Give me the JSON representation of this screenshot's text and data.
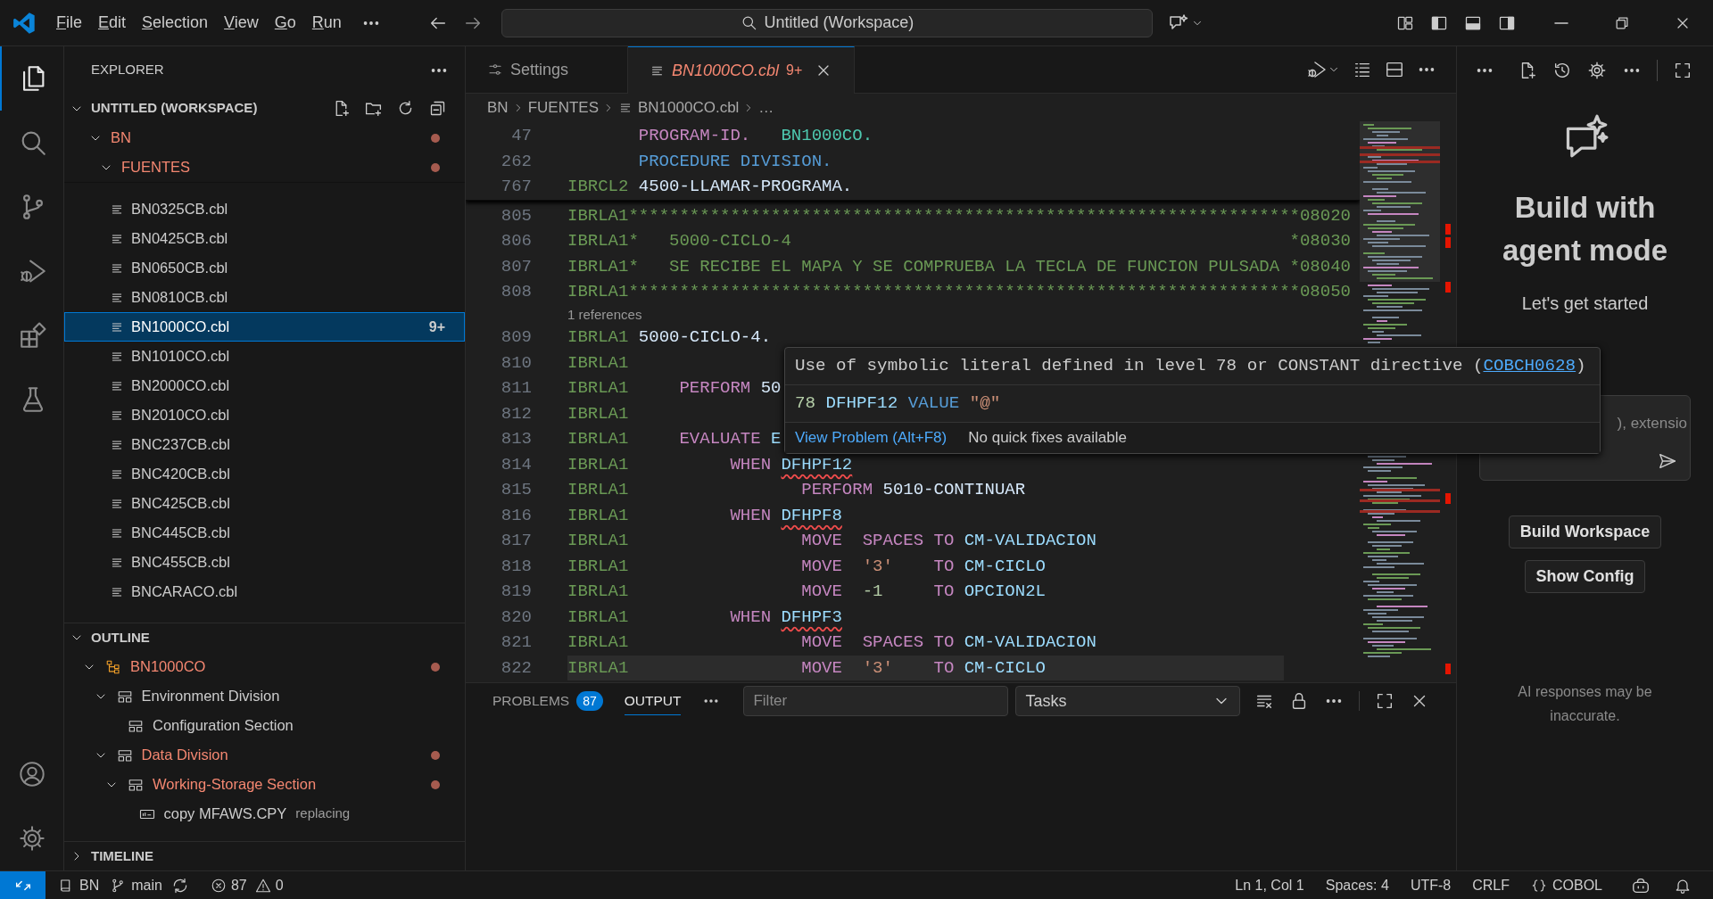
{
  "title_bar": {
    "menu": [
      "File",
      "Edit",
      "Selection",
      "View",
      "Go",
      "Run"
    ],
    "search": "Untitled (Workspace)"
  },
  "activity_bar": {
    "top": [
      {
        "kind": "explorer",
        "selected": true
      },
      {
        "kind": "search",
        "selected": false
      },
      {
        "kind": "source_control",
        "selected": false
      },
      {
        "kind": "run_debug",
        "selected": false
      },
      {
        "kind": "extensions",
        "selected": false
      },
      {
        "kind": "testing",
        "selected": false
      }
    ],
    "bottom": [
      {
        "kind": "accounts"
      },
      {
        "kind": "manage"
      }
    ]
  },
  "sidebar": {
    "title": "EXPLORER",
    "explorer": {
      "label": "UNTITLED (WORKSPACE)",
      "expanded": true,
      "tree": [
        {
          "label": "BN",
          "errors": true,
          "expanded": true,
          "children": [
            {
              "label": "FUENTES",
              "errors": true,
              "expanded": true,
              "children": [
                {
                  "label": "BN0325CB.cbl",
                  "selected": false
                },
                {
                  "label": "BN0425CB.cbl",
                  "selected": false
                },
                {
                  "label": "BN0650CB.cbl",
                  "selected": false
                },
                {
                  "label": "BN0810CB.cbl",
                  "selected": false
                },
                {
                  "label": "BN1000CO.cbl",
                  "selected": true,
                  "badge": "9+"
                },
                {
                  "label": "BN1010CO.cbl",
                  "selected": false
                },
                {
                  "label": "BN2000CO.cbl",
                  "selected": false
                },
                {
                  "label": "BN2010CO.cbl",
                  "selected": false
                },
                {
                  "label": "BNC237CB.cbl",
                  "selected": false
                },
                {
                  "label": "BNC420CB.cbl",
                  "selected": false
                },
                {
                  "label": "BNC425CB.cbl",
                  "selected": false
                },
                {
                  "label": "BNC445CB.cbl",
                  "selected": false
                },
                {
                  "label": "BNC455CB.cbl",
                  "selected": false
                },
                {
                  "label": "BNCARACO.cbl",
                  "selected": false
                }
              ]
            }
          ]
        }
      ]
    },
    "outline": {
      "label": "OUTLINE",
      "expanded": true,
      "tree": [
        {
          "label": "BN1000CO",
          "kind": "program",
          "errors": true,
          "expanded": true,
          "children": [
            {
              "label": "Environment Division",
              "kind": "division",
              "errors": false,
              "expanded": true,
              "children": [
                {
                  "label": "Configuration Section",
                  "kind": "section",
                  "errors": false
                }
              ]
            },
            {
              "label": "Data Division",
              "kind": "division",
              "errors": true,
              "expanded": true,
              "children": [
                {
                  "label": "Working-Storage Section",
                  "kind": "section",
                  "errors": true,
                  "expanded": true,
                  "children": [
                    {
                      "label": "copy MFAWS.CPY",
                      "kind": "copy",
                      "errors": false,
                      "description": "replacing"
                    }
                  ]
                }
              ]
            }
          ]
        }
      ]
    },
    "timeline": {
      "label": "TIMELINE",
      "expanded": false
    }
  },
  "editor": {
    "tabs": [
      {
        "label": "Settings",
        "kind": "settings",
        "selected": false,
        "preview": false,
        "errors": false
      },
      {
        "label": "BN1000CO.cbl",
        "kind": "file",
        "selected": true,
        "preview": true,
        "errors": true,
        "badge": "9+"
      }
    ],
    "breadcrumb": [
      {
        "label": "BN",
        "kind": "folder"
      },
      {
        "label": "FUENTES",
        "kind": "folder"
      },
      {
        "label": "BN1000CO.cbl",
        "kind": "file"
      },
      {
        "label": "…",
        "kind": "more"
      }
    ],
    "sticky_lines": [
      {
        "number": "47",
        "segments": [
          {
            "text": "       PROGRAM-ID.",
            "kind": "keyword"
          },
          {
            "text": "   BN1000CO.",
            "kind": "program"
          }
        ]
      },
      {
        "number": "262",
        "segments": [
          {
            "text": "       PROCEDURE DIVISION.",
            "kind": "division"
          }
        ]
      },
      {
        "number": "767",
        "segments": [
          {
            "text": "IBRCL2",
            "kind": "seq"
          },
          {
            "text": " 4500-LLAMAR-PROGRAMA.",
            "kind": "paragraph"
          }
        ]
      }
    ],
    "lines": [
      {
        "kind": "code",
        "number": "805",
        "current": false,
        "segments": [
          {
            "text": "IBRLA1",
            "kind": "seq"
          },
          {
            "text": "******************************************************************08020",
            "kind": "comment"
          }
        ]
      },
      {
        "kind": "code",
        "number": "806",
        "current": false,
        "segments": [
          {
            "text": "IBRLA1",
            "kind": "seq"
          },
          {
            "text": "*   5000-CICLO-4                                                 *08030",
            "kind": "comment"
          }
        ]
      },
      {
        "kind": "code",
        "number": "807",
        "current": false,
        "segments": [
          {
            "text": "IBRLA1",
            "kind": "seq"
          },
          {
            "text": "*   SE RECIBE EL MAPA Y SE COMPRUEBA LA TECLA DE FUNCION PULSADA *08040",
            "kind": "comment"
          }
        ]
      },
      {
        "kind": "code",
        "number": "808",
        "current": false,
        "segments": [
          {
            "text": "IBRLA1",
            "kind": "seq"
          },
          {
            "text": "******************************************************************08050",
            "kind": "comment"
          }
        ]
      },
      {
        "kind": "codelens",
        "text": "1 references"
      },
      {
        "kind": "code",
        "number": "809",
        "current": false,
        "segments": [
          {
            "text": "IBRLA1",
            "kind": "seq"
          },
          {
            "text": " 5000-CICLO-4.",
            "kind": "paragraph"
          }
        ]
      },
      {
        "kind": "code",
        "number": "810",
        "current": false,
        "segments": [
          {
            "text": "IBRLA1",
            "kind": "seq"
          }
        ]
      },
      {
        "kind": "code",
        "number": "811",
        "current": false,
        "segments": [
          {
            "text": "IBRLA1",
            "kind": "seq"
          },
          {
            "text": "     PERFORM",
            "kind": "keyword"
          },
          {
            "text": " 50",
            "kind": "paragraph"
          }
        ]
      },
      {
        "kind": "code",
        "number": "812",
        "current": false,
        "segments": [
          {
            "text": "IBRLA1",
            "kind": "seq"
          }
        ]
      },
      {
        "kind": "code",
        "number": "813",
        "current": false,
        "segments": [
          {
            "text": "IBRLA1",
            "kind": "seq"
          },
          {
            "text": "     EVALUATE",
            "kind": "keyword"
          },
          {
            "text": " E",
            "kind": "identifier"
          }
        ]
      },
      {
        "kind": "code",
        "number": "814",
        "current": false,
        "segments": [
          {
            "text": "IBRLA1",
            "kind": "seq"
          },
          {
            "text": "          WHEN ",
            "kind": "keyword"
          },
          {
            "text": "DFHPF12",
            "kind": "identifier",
            "squiggle": true
          }
        ]
      },
      {
        "kind": "code",
        "number": "815",
        "current": false,
        "segments": [
          {
            "text": "IBRLA1",
            "kind": "seq"
          },
          {
            "text": "                 PERFORM",
            "kind": "keyword"
          },
          {
            "text": " 5010-CONTINUAR",
            "kind": "paragraph"
          }
        ]
      },
      {
        "kind": "code",
        "number": "816",
        "current": false,
        "segments": [
          {
            "text": "IBRLA1",
            "kind": "seq"
          },
          {
            "text": "          WHEN ",
            "kind": "keyword"
          },
          {
            "text": "DFHPF8",
            "kind": "identifier",
            "squiggle": true
          }
        ]
      },
      {
        "kind": "code",
        "number": "817",
        "current": false,
        "segments": [
          {
            "text": "IBRLA1",
            "kind": "seq"
          },
          {
            "text": "                 MOVE  SPACES TO",
            "kind": "keyword"
          },
          {
            "text": " CM-VALIDACION",
            "kind": "identifier"
          }
        ]
      },
      {
        "kind": "code",
        "number": "818",
        "current": false,
        "segments": [
          {
            "text": "IBRLA1",
            "kind": "seq"
          },
          {
            "text": "                 MOVE  ",
            "kind": "keyword"
          },
          {
            "text": "'3'",
            "kind": "string"
          },
          {
            "text": "    TO",
            "kind": "keyword"
          },
          {
            "text": " CM-CICLO",
            "kind": "identifier"
          }
        ]
      },
      {
        "kind": "code",
        "number": "819",
        "current": false,
        "segments": [
          {
            "text": "IBRLA1",
            "kind": "seq"
          },
          {
            "text": "                 MOVE  ",
            "kind": "keyword"
          },
          {
            "text": "-1",
            "kind": "number"
          },
          {
            "text": "     TO",
            "kind": "keyword"
          },
          {
            "text": " OPCION2L",
            "kind": "identifier"
          }
        ]
      },
      {
        "kind": "code",
        "number": "820",
        "current": false,
        "segments": [
          {
            "text": "IBRLA1",
            "kind": "seq"
          },
          {
            "text": "          WHEN ",
            "kind": "keyword"
          },
          {
            "text": "DFHPF3",
            "kind": "identifier",
            "squiggle": true
          }
        ]
      },
      {
        "kind": "code",
        "number": "821",
        "current": false,
        "segments": [
          {
            "text": "IBRLA1",
            "kind": "seq"
          },
          {
            "text": "                 MOVE  SPACES TO",
            "kind": "keyword"
          },
          {
            "text": " CM-VALIDACION",
            "kind": "identifier"
          }
        ]
      },
      {
        "kind": "code",
        "number": "822",
        "current": true,
        "segments": [
          {
            "text": "IBRLA1",
            "kind": "seq"
          },
          {
            "text": "                 MOVE  ",
            "kind": "keyword"
          },
          {
            "text": "'3'",
            "kind": "string"
          },
          {
            "text": "    TO",
            "kind": "keyword"
          },
          {
            "text": " CM-CICLO",
            "kind": "identifier"
          }
        ]
      }
    ],
    "hover": {
      "message": [
        {
          "text": "Use of symbolic literal defined in level 78 or CONSTANT directive (",
          "kind": "plain"
        },
        {
          "text": "COBCH0628",
          "kind": "link"
        },
        {
          "text": ")",
          "kind": "plain"
        }
      ],
      "definition": [
        {
          "text": "78",
          "kind": "number"
        },
        {
          "text": " DFHPF12",
          "kind": "identifier"
        },
        {
          "text": " VALUE",
          "kind": "division"
        },
        {
          "text": " \"@\"",
          "kind": "string"
        }
      ],
      "action": "View Problem (Alt+F8)",
      "note": "No quick fixes available"
    }
  },
  "panel": {
    "tabs": [
      {
        "label": "PROBLEMS",
        "badge": "87",
        "selected": false
      },
      {
        "label": "OUTPUT",
        "selected": true
      }
    ],
    "filter": {
      "placeholder": "Filter"
    },
    "channel": "Tasks"
  },
  "chat": {
    "heading": "Build with agent mode",
    "subheading": "Let's get started",
    "input": {
      "placeholder": "), extensio"
    },
    "buttons": [
      "Build Workspace",
      "Show Config"
    ],
    "disclaimer": "AI responses may be inaccurate."
  },
  "status_bar": {
    "workspace": "BN",
    "branch": "main",
    "errors": "87",
    "warnings": "0",
    "items": [
      "Ln 1, Col 1",
      "Spaces: 4",
      "UTF-8",
      "CRLF"
    ],
    "language": "COBOL"
  }
}
